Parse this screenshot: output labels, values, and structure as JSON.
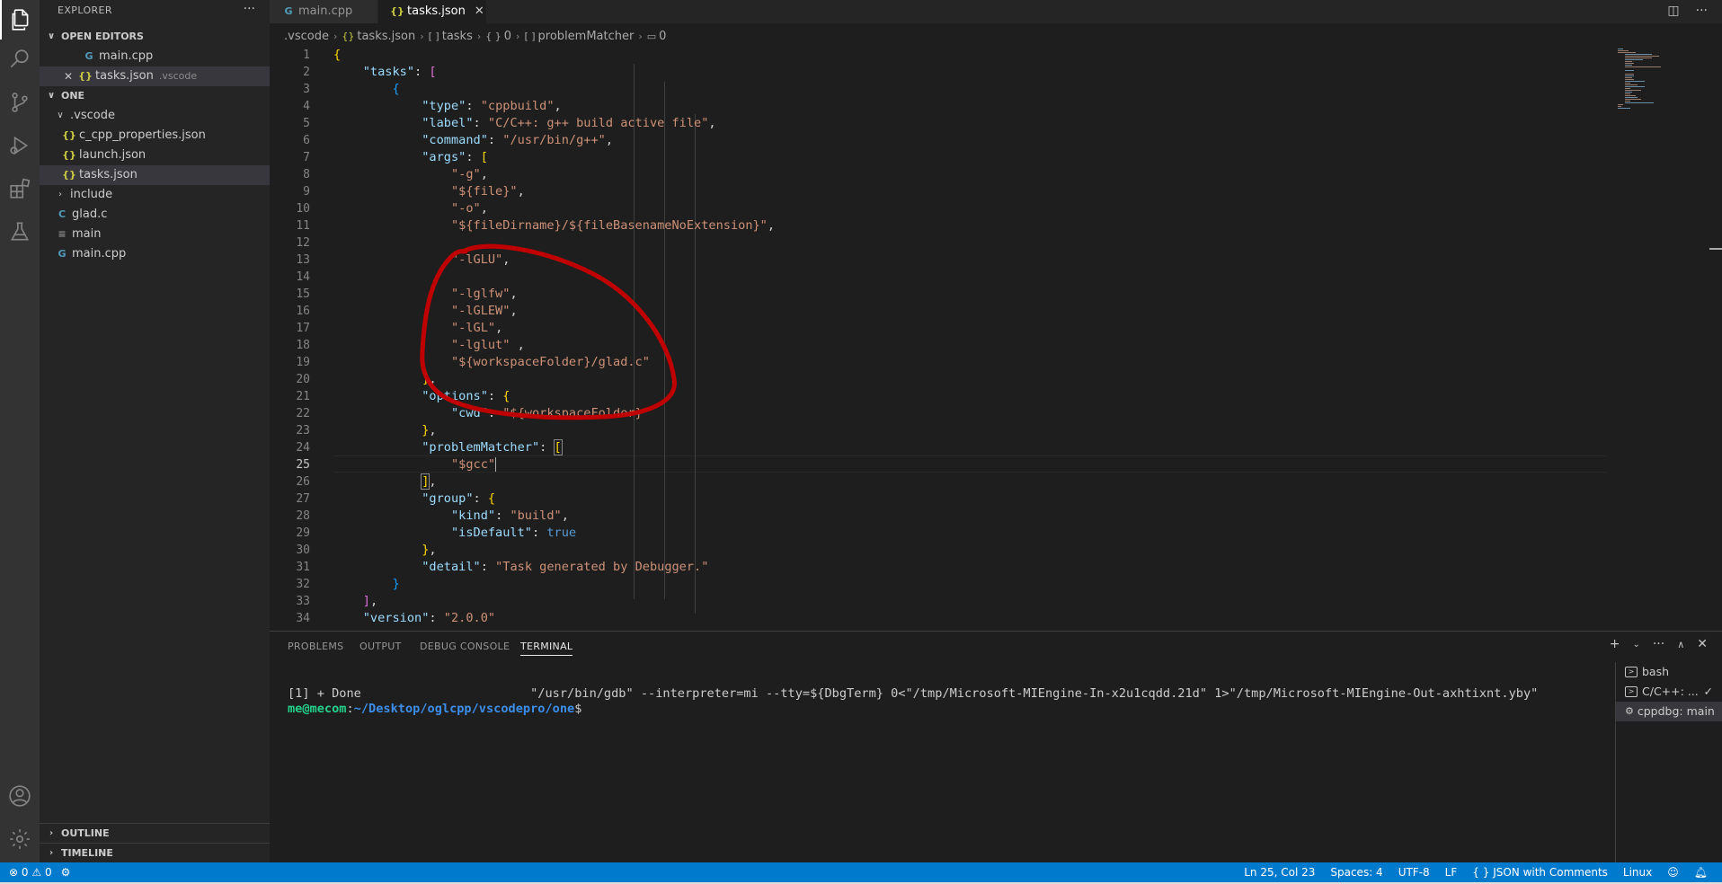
{
  "sidebar": {
    "title": "EXPLORER",
    "more": "···",
    "open_editors": {
      "header": "OPEN EDITORS",
      "items": [
        {
          "name": "main.cpp",
          "icon": "cpp-file-icon"
        },
        {
          "name": "tasks.json",
          "desc": ".vscode",
          "icon": "json-file-icon"
        }
      ]
    },
    "folder": {
      "header": "ONE",
      "items": [
        {
          "name": ".vscode",
          "type": "folder"
        },
        {
          "name": "c_cpp_properties.json",
          "icon": "json-file-icon"
        },
        {
          "name": "launch.json",
          "icon": "json-file-icon"
        },
        {
          "name": "tasks.json",
          "icon": "json-file-icon"
        },
        {
          "name": "include",
          "type": "folder"
        },
        {
          "name": "glad.c",
          "icon": "c-file-icon"
        },
        {
          "name": "main",
          "icon": "text-file-icon"
        },
        {
          "name": "main.cpp",
          "icon": "cpp-file-icon"
        }
      ]
    },
    "outline": "OUTLINE",
    "timeline": "TIMELINE"
  },
  "tabs": [
    {
      "label": "main.cpp",
      "active": false
    },
    {
      "label": "tasks.json",
      "active": true
    }
  ],
  "breadcrumb": {
    "folder": ".vscode",
    "file": "tasks.json",
    "tasks": "tasks",
    "index": "0",
    "problemMatcher": "problemMatcher",
    "index2": "0"
  },
  "editor": {
    "line_numbers": [
      "1",
      "2",
      "3",
      "4",
      "5",
      "6",
      "7",
      "8",
      "9",
      "10",
      "11",
      "12",
      "13",
      "14",
      "15",
      "16",
      "17",
      "18",
      "19",
      "20",
      "21",
      "22",
      "23",
      "24",
      "25",
      "26",
      "27",
      "28",
      "29",
      "30",
      "31",
      "32",
      "33",
      "34"
    ],
    "code": {
      "tasks_key": "\"tasks\"",
      "type_key": "\"type\"",
      "type_val": "\"cppbuild\"",
      "label_key": "\"label\"",
      "label_val": "\"C/C++: g++ build active file\"",
      "command_key": "\"command\"",
      "command_val": "\"/usr/bin/g++\"",
      "args_key": "\"args\"",
      "arg_g": "\"-g\"",
      "arg_file": "\"${file}\"",
      "arg_o": "\"-o\"",
      "arg_out": "\"${fileDirname}/${fileBasenameNoExtension}\"",
      "arg_lglu": "\"-lGLU\"",
      "arg_lglfw": "\"-lglfw\"",
      "arg_lglew": "\"-lGLEW\"",
      "arg_lgl": "\"-lGL\"",
      "arg_lglut": "\"-lglut\"",
      "arg_glad": "\"${workspaceFolder}/glad.c\"",
      "options_key": "\"options\"",
      "cwd_key": "\"cwd\"",
      "cwd_val": "\"${workspaceFolder}\"",
      "pm_key": "\"problemMatcher\"",
      "pm_val": "\"$gcc\"",
      "group_key": "\"group\"",
      "kind_key": "\"kind\"",
      "kind_val": "\"build\"",
      "isdefault_key": "\"isDefault\"",
      "isdefault_val": "true",
      "detail_key": "\"detail\"",
      "detail_val": "\"Task generated by Debugger.\"",
      "version_key": "\"version\"",
      "version_val": "\"2.0.0\""
    },
    "annotation_color": "#c00000"
  },
  "panel": {
    "tabs": [
      "PROBLEMS",
      "OUTPUT",
      "DEBUG CONSOLE",
      "TERMINAL"
    ],
    "active_tab": "TERMINAL",
    "terminal": {
      "line1_prefix": "[1] + Done",
      "line1_cmd": "\"/usr/bin/gdb\" --interpreter=mi --tty=${DbgTerm} 0<\"/tmp/Microsoft-MIEngine-In-x2u1cqdd.21d\" 1>\"/tmp/Microsoft-MIEngine-Out-axhtixnt.yby\"",
      "prompt_user": "me@mecom",
      "prompt_sep": ":",
      "prompt_path": "~/Desktop/oglcpp/vscodepro/one",
      "prompt_end": "$"
    },
    "terminals": [
      {
        "label": "bash",
        "selected": false,
        "check": ""
      },
      {
        "label": "C/C++: ...",
        "selected": false,
        "check": "✓"
      },
      {
        "label": "cppdbg: main",
        "selected": true,
        "check": ""
      }
    ]
  },
  "statusbar": {
    "errors": "0",
    "warnings": "0",
    "position": "Ln 25, Col 23",
    "spaces": "Spaces: 4",
    "encoding": "UTF-8",
    "eol": "LF",
    "language": "JSON with Comments",
    "os": "Linux"
  },
  "colors": {
    "accent": "#007acc",
    "string": "#ce9178",
    "key": "#9cdcfe"
  }
}
